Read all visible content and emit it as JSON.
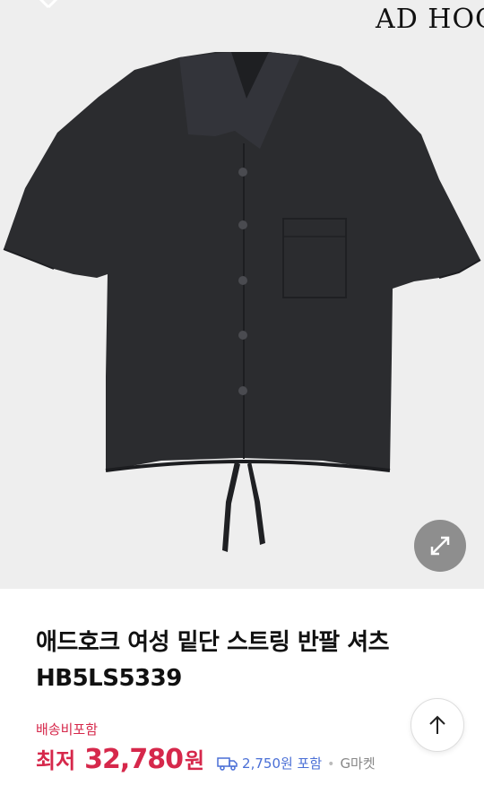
{
  "header": {
    "brand_logo_text": "AD HOC"
  },
  "product": {
    "image_name": "shirt",
    "title": "애드호크 여성 밑단 스트링 반팔 셔츠 HB5LS5339",
    "shipping_label": "배송비포함",
    "price_label": "최저",
    "price_value": "32,780",
    "price_unit": "원",
    "shipping_fee": "2,750원 포함",
    "seller": "G마켓"
  },
  "icons": {
    "close": "close-icon",
    "expand": "expand-icon",
    "truck": "truck-icon",
    "scroll_top": "arrow-up-icon"
  },
  "colors": {
    "price": "#d6284b",
    "shipping_fee": "#4a6fd6",
    "background_image": "#eeeeee"
  }
}
